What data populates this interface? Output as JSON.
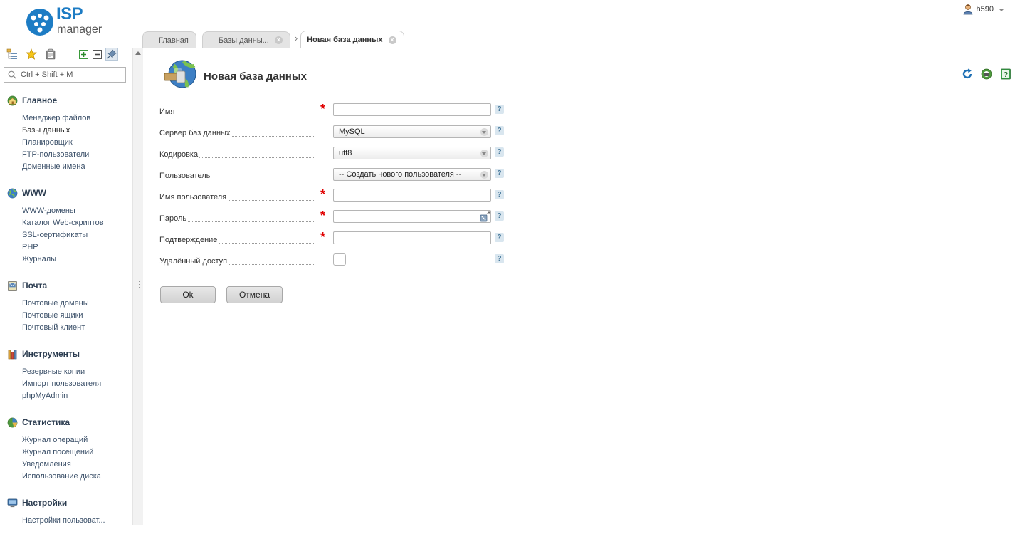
{
  "app": {
    "logo_top": "ISP",
    "logo_bottom": "manager"
  },
  "user": {
    "name": "h590"
  },
  "tabs": [
    {
      "label": "Главная"
    },
    {
      "label": "Базы данны..."
    },
    {
      "label": "Новая база данных"
    }
  ],
  "sidebar": {
    "search_placeholder": "Ctrl + Shift + M",
    "groups": [
      {
        "title": "Главное",
        "icon": "home-icon",
        "items": [
          "Менеджер файлов",
          "Базы данных",
          "Планировщик",
          "FTP-пользователи",
          "Доменные имена"
        ]
      },
      {
        "title": "WWW",
        "icon": "globe-icon",
        "items": [
          "WWW-домены",
          "Каталог Web-скриптов",
          "SSL-сертификаты",
          "PHP",
          "Журналы"
        ]
      },
      {
        "title": "Почта",
        "icon": "mail-icon",
        "items": [
          "Почтовые домены",
          "Почтовые ящики",
          "Почтовый клиент"
        ]
      },
      {
        "title": "Инструменты",
        "icon": "tools-icon",
        "items": [
          "Резервные копии",
          "Импорт пользователя",
          "phpMyAdmin"
        ]
      },
      {
        "title": "Статистика",
        "icon": "pie-chart-icon",
        "items": [
          "Журнал операций",
          "Журнал посещений",
          "Уведомления",
          "Использование диска"
        ]
      },
      {
        "title": "Настройки",
        "icon": "monitor-icon",
        "items": [
          "Настройки пользоват..."
        ]
      }
    ],
    "active_item": "Базы данных"
  },
  "page": {
    "title": "Новая база данных"
  },
  "form": {
    "fields": [
      {
        "label": "Имя",
        "required": true,
        "type": "text",
        "value": ""
      },
      {
        "label": "Сервер баз данных",
        "required": false,
        "type": "select",
        "value": "MySQL"
      },
      {
        "label": "Кодировка",
        "required": false,
        "type": "select",
        "value": "utf8"
      },
      {
        "label": "Пользователь",
        "required": false,
        "type": "select",
        "value": "-- Создать нового пользователя --"
      },
      {
        "label": "Имя пользователя",
        "required": true,
        "type": "text",
        "value": ""
      },
      {
        "label": "Пароль",
        "required": true,
        "type": "password",
        "value": ""
      },
      {
        "label": "Подтверждение",
        "required": true,
        "type": "password",
        "value": ""
      },
      {
        "label": "Удалённый доступ",
        "required": false,
        "type": "checkbox",
        "value": ""
      }
    ],
    "required_mark": "*",
    "help_mark": "?",
    "ok_label": "Ok",
    "cancel_label": "Отмена"
  },
  "colors": {
    "link": "#3a4f68",
    "required": "#e00000",
    "brand": "#1d7cc4"
  }
}
